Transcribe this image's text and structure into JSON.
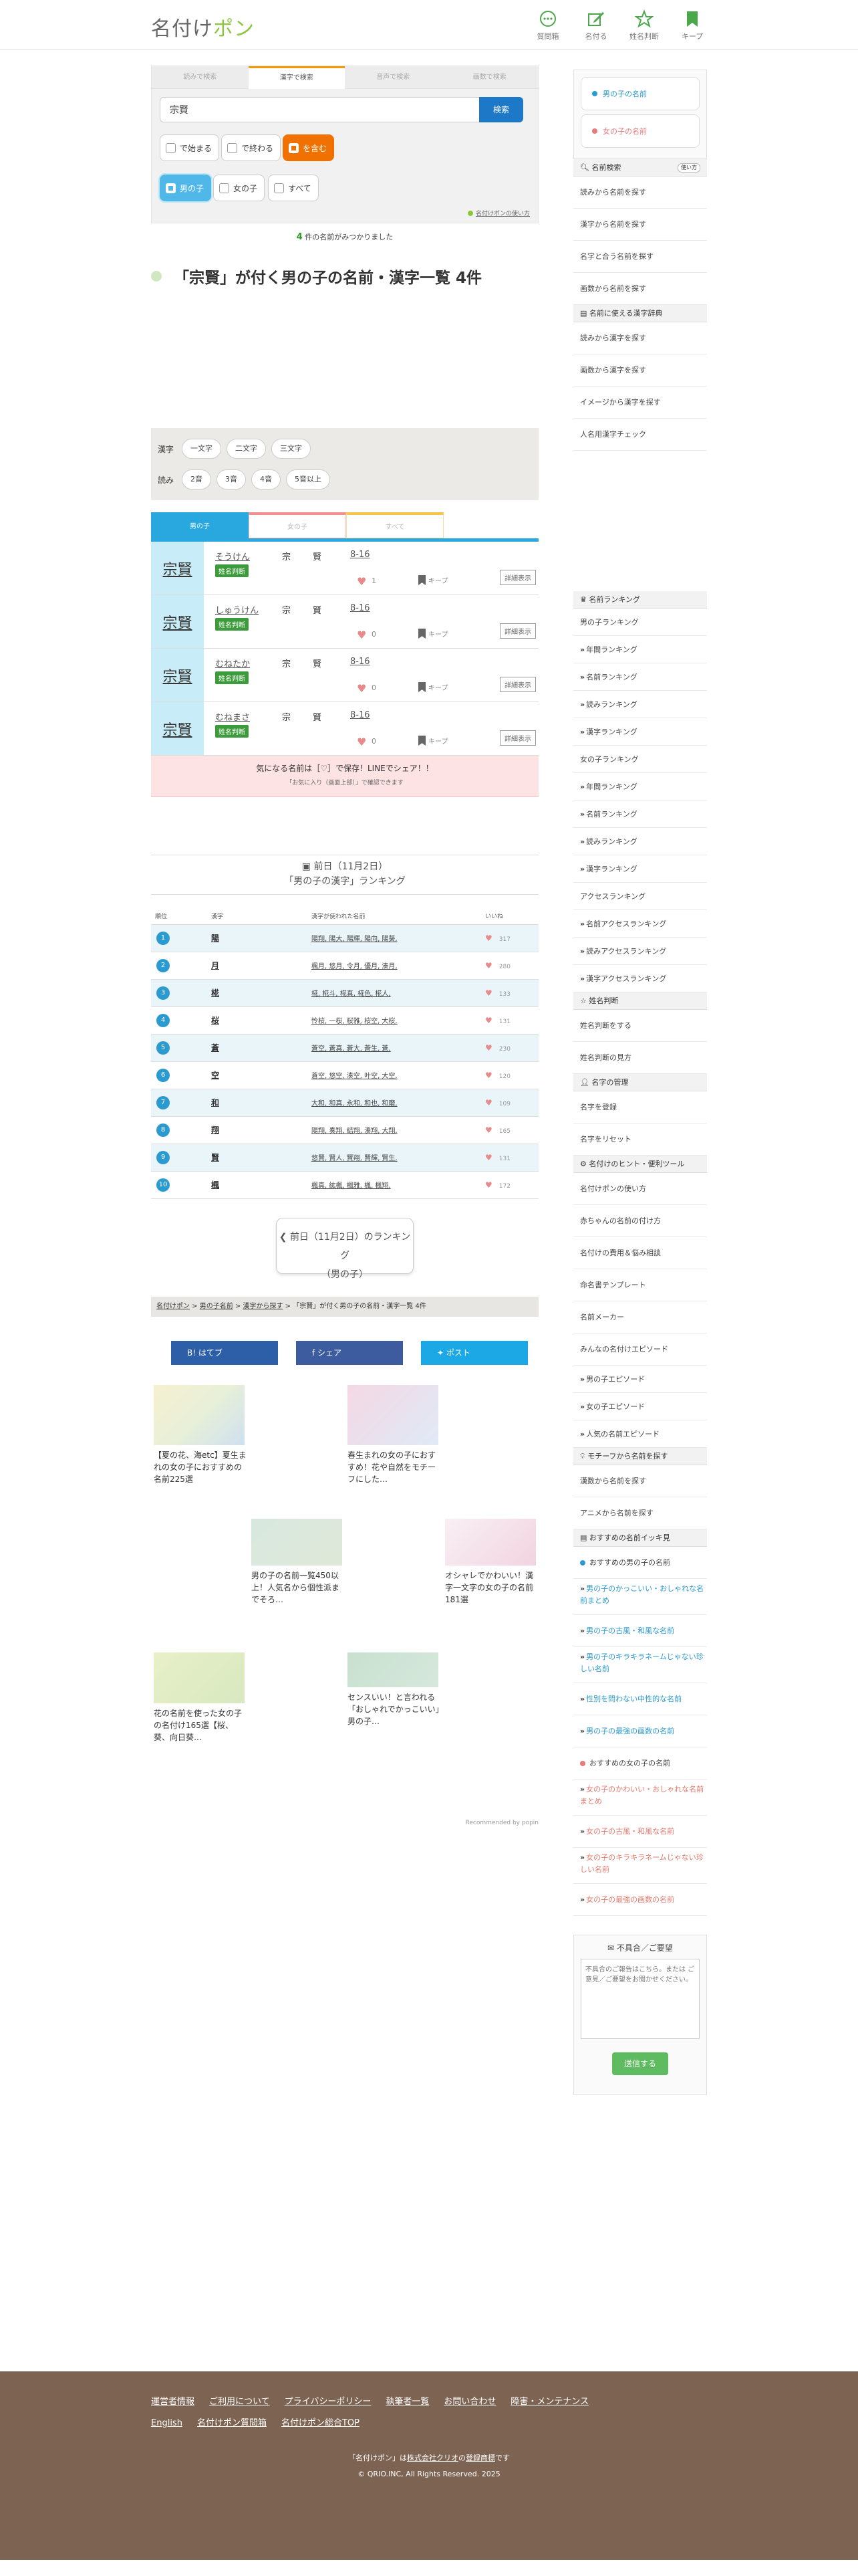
{
  "header": {
    "logo_a": "名付け",
    "logo_b": "ポン",
    "nav": [
      {
        "label": "質問箱",
        "icon": "question-box-icon"
      },
      {
        "label": "名付る",
        "icon": "pencil-note-icon"
      },
      {
        "label": "姓名判断",
        "icon": "star-outline-icon"
      },
      {
        "label": "キープ",
        "icon": "bookmark-icon"
      }
    ]
  },
  "search": {
    "tabs": [
      "読みで検索",
      "漢字で検索",
      "音声で検索",
      "画数で検索"
    ],
    "active_tab": 1,
    "value": "宗賢",
    "button": "検索",
    "match_options": [
      "で始まる",
      "で終わる",
      "を含む"
    ],
    "gender_options": [
      "男の子",
      "女の子",
      "すべて"
    ],
    "howto": "名付けポンの使い方"
  },
  "result_summary": {
    "count": "4",
    "suffix": "件の名前がみつかりました"
  },
  "page_title": "「宗賢」が付く男の子の名前・漢字一覧 4件",
  "filter": {
    "kanji_label": "漢字",
    "kanji_options": [
      "一文字",
      "二文字",
      "三文字"
    ],
    "yomi_label": "読み",
    "yomi_options": [
      "2音",
      "3音",
      "4音",
      "5音以上"
    ]
  },
  "result_tabs": [
    "男の子",
    "女の子",
    "すべて"
  ],
  "results": [
    {
      "kanji": "宗賢",
      "reading": "そうけん",
      "badge": "姓名判断",
      "c1": "宗",
      "c2": "賢",
      "strokes": "8-16",
      "likes": "1",
      "keep": "キープ",
      "detail": "詳細表示"
    },
    {
      "kanji": "宗賢",
      "reading": "しゅうけん",
      "badge": "姓名判断",
      "c1": "宗",
      "c2": "賢",
      "strokes": "8-16",
      "likes": "0",
      "keep": "キープ",
      "detail": "詳細表示"
    },
    {
      "kanji": "宗賢",
      "reading": "むねたか",
      "badge": "姓名判断",
      "c1": "宗",
      "c2": "賢",
      "strokes": "8-16",
      "likes": "0",
      "keep": "キープ",
      "detail": "詳細表示"
    },
    {
      "kanji": "宗賢",
      "reading": "むねまさ",
      "badge": "姓名判断",
      "c1": "宗",
      "c2": "賢",
      "strokes": "8-16",
      "likes": "0",
      "keep": "キープ",
      "detail": "詳細表示"
    }
  ],
  "save_notice": {
    "main": "気になる名前は［♡］で保存！LINEでシェア！！",
    "sub": "「お気に入り（画面上部）」で確認できます"
  },
  "ranking": {
    "date_line": "前日（11月2日）",
    "title": "「男の子の漢字」ランキング",
    "headers": [
      "順位",
      "漢字",
      "漢字が使われた名前",
      "いいね"
    ],
    "rows": [
      {
        "rank": "1",
        "kanji": "陽",
        "names": "陽翔, 陽大, 陽輝, 陽向, 陽葵,",
        "likes": "317"
      },
      {
        "rank": "2",
        "kanji": "月",
        "names": "楓月, 悠月, 令月, 優月, 湊月,",
        "likes": "280"
      },
      {
        "rank": "3",
        "kanji": "椛",
        "names": "椛, 椛斗, 椛真, 椛色, 椛人,",
        "likes": "133"
      },
      {
        "rank": "4",
        "kanji": "桜",
        "names": "怜桜, 一桜, 桜雅, 桜空, 大桜,",
        "likes": "131"
      },
      {
        "rank": "5",
        "kanji": "蒼",
        "names": "蒼空, 蒼真, 蒼大, 蒼生, 蒼,",
        "likes": "230"
      },
      {
        "rank": "6",
        "kanji": "空",
        "names": "蒼空, 悠空, 湊空, 叶空, 大空,",
        "likes": "120"
      },
      {
        "rank": "7",
        "kanji": "和",
        "names": "大和, 和真, 永和, 和也, 和磨,",
        "likes": "109"
      },
      {
        "rank": "8",
        "kanji": "翔",
        "names": "陽翔, 奏翔, 結翔, 湊翔, 大翔,",
        "likes": "165"
      },
      {
        "rank": "9",
        "kanji": "賢",
        "names": "悠賢, 賢人, 賢翔, 賢輝, 賢生,",
        "likes": "131"
      },
      {
        "rank": "10",
        "kanji": "楓",
        "names": "楓真, 紘楓, 楓雅, 楓, 楓翔,",
        "likes": "172"
      }
    ],
    "prev_button_a": "前日（11月2日）のランキング",
    "prev_button_b": "（男の子）"
  },
  "breadcrumb": [
    "名付けポン",
    "男の子名前",
    "漢字から探す",
    "「宗賢」が付く男の子の名前・漢字一覧 4件"
  ],
  "share": [
    "はてブ",
    "シェア",
    "ポスト"
  ],
  "recommendations": [
    {
      "title": "【夏の花、海etc】夏生まれの女の子におすすめの名前225選",
      "color": "#e8f0d8"
    },
    {
      "title": "春生まれの女の子におすすめ！花や自然をモチーフにした…",
      "color": "#f4d8e4"
    },
    {
      "title": "男の子の名前一覧450以上！人気名から個性派までそろ…",
      "color": "#dfe8d8"
    },
    {
      "title": "オシャレでかわいい！漢字一文字の女の子の名前181選",
      "color": "#f2d4e0"
    },
    {
      "title": "花の名前を使った女の子の名付け165選【桜、葵、向日葵…",
      "color": "#d8e8c0"
    },
    {
      "title": "センスいい！と言われる「おしゃれでかっこいい」男の子…",
      "color": "#d6e8dc"
    }
  ],
  "recommended_by": "Recommended by",
  "popin": "popin",
  "sidebar": {
    "gender": [
      "男の子の名前",
      "女の子の名前"
    ],
    "search_h": "名前検索",
    "search_tip": "使い方",
    "search_items": [
      "読みから名前を探す",
      "漢字から名前を探す",
      "名字と合う名前を探す",
      "画数から名前を探す"
    ],
    "dict_h": "名前に使える漢字辞典",
    "dict_items": [
      "読みから漢字を探す",
      "画数から漢字を探す",
      "イメージから漢字を探す",
      "人名用漢字チェック"
    ],
    "rank_h": "名前ランキング",
    "rank_boy": [
      "男の子ランキング",
      "年間ランキング",
      "名前ランキング",
      "読みランキング",
      "漢字ランキング"
    ],
    "rank_girl": [
      "女の子ランキング",
      "年間ランキング",
      "名前ランキング",
      "読みランキング",
      "漢字ランキング"
    ],
    "rank_access": [
      "アクセスランキング",
      "名前アクセスランキング",
      "読みアクセスランキング",
      "漢字アクセスランキング"
    ],
    "judge_h": "姓名判断",
    "judge_items": [
      "姓名判断をする",
      "姓名判断の見方"
    ],
    "manage_h": "名字の管理",
    "manage_items": [
      "名字を登録",
      "名字をリセット"
    ],
    "tools_h": "名付けのヒント・便利ツール",
    "tools_items": [
      "名付けポンの使い方",
      "赤ちゃんの名前の付け方",
      "名付けの費用＆悩み相談",
      "命名書テンプレート",
      "名前メーカー",
      "みんなの名付けエピソード"
    ],
    "tools_sub": [
      "男の子エピソード",
      "女の子エピソード",
      "人気の名前エピソード"
    ],
    "motif_h": "モチーフから名前を探す",
    "motif_items": [
      "漢数から名前を探す",
      "アニメから名前を探す"
    ],
    "rec_h": "おすすめの名前イッキ見",
    "rec_boy_h": "おすすめの男の子の名前",
    "rec_boy": [
      "男の子のかっこいい・おしゃれな名前まとめ",
      "男の子の古風・和風な名前",
      "男の子のキラキラネームじゃない珍しい名前",
      "性別を問わない中性的な名前",
      "男の子の最強の画数の名前"
    ],
    "rec_girl_h": "おすすめの女の子の名前",
    "rec_girl": [
      "女の子のかわいい・おしゃれな名前まとめ",
      "女の子の古風・和風な名前",
      "女の子のキラキラネームじゃない珍しい名前",
      "女の子の最強の画数の名前"
    ],
    "feedback_h": "不具合／ご要望",
    "feedback_placeholder": "不具合のご報告はこちら。または ご意見／ご要望をお聞かせください。",
    "feedback_send": "送信する"
  },
  "footer": {
    "links": [
      "運営者情報",
      "ご利用について",
      "プライバシーポリシー",
      "執筆者一覧",
      "お問い合わせ",
      "障害・メンテナンス",
      "English",
      "名付けポン質問箱",
      "名付けポン総合TOP"
    ],
    "note_a": "「名付けポン」は",
    "note_link": "株式会社クリオ",
    "note_b": "の",
    "note_link2": "登録商標",
    "note_c": "です",
    "copyright": "© QRIO.INC, All Rights Reserved. 2025"
  },
  "colors": {
    "brand_green": "#8cc63f",
    "boy_blue": "#29a8e0",
    "accent_orange": "#f07000",
    "footer_brown": "#7d6352"
  }
}
